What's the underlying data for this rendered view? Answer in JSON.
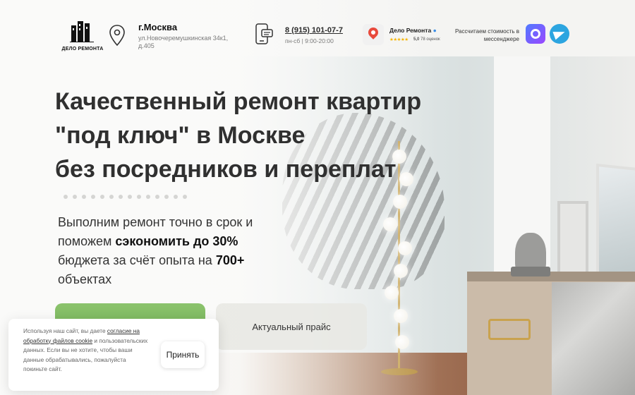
{
  "header": {
    "logo_text": "ДЕЛО РЕМОНТА",
    "city": "г.Москва",
    "address": "ул.Новочеремушкинская 34к1, д.405",
    "phone": "8 (915) 101-07-7",
    "hours": "пн-сб | 9:00-20:00",
    "review": {
      "name": "Дело Ремонта",
      "stars": "★★★★★",
      "rating": "5,0",
      "count": "78 оценок"
    },
    "messenger_text": "Рассчитаем стоимость в мессенджере"
  },
  "hero": {
    "headline_line1": "Качественный ремонт квартир",
    "headline_line2": "\"под ключ\" в Москве",
    "headline_line3": "без посредников и переплат",
    "sub_part1": "Выполним ремонт точно в срок и поможем ",
    "sub_bold1": "сэкономить до 30%",
    "sub_part2": " бюджета за счёт опыта на ",
    "sub_bold2": "700+",
    "sub_part3": " объектах",
    "price_button": "Актуальный прайс"
  },
  "cookie": {
    "text_before": "Используя наш сайт, вы даете ",
    "link": "согласие на обработку файлов cookie",
    "text_after": " и пользовательских данных. Если вы не хотите, чтобы ваши данные обрабатывались, пожалуйста покиньте сайт.",
    "accept": "Принять"
  },
  "colors": {
    "accent_green": "#7cb85e",
    "telegram": "#2ca5e0",
    "map_red": "#e84a3c"
  },
  "icons": [
    "logo-icon",
    "location-pin-icon",
    "phone-chat-icon",
    "yandex-maps-icon",
    "max-messenger-icon",
    "telegram-icon"
  ]
}
